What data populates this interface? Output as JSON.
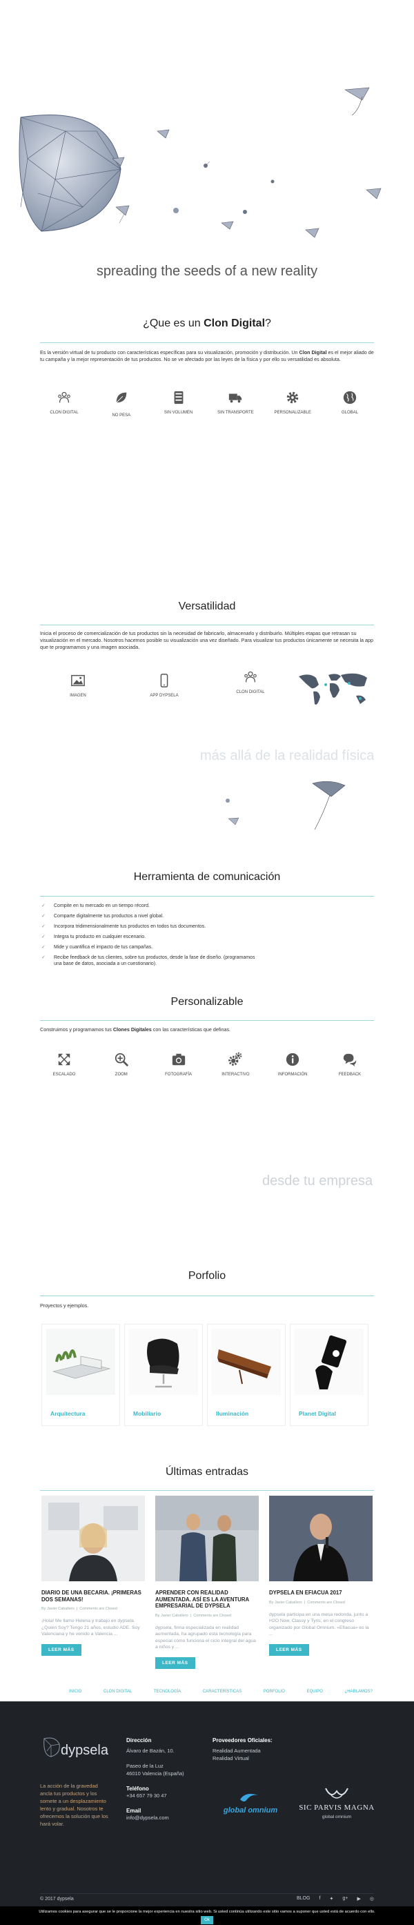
{
  "hero": {
    "tagline": "spreading the seeds of a new reality"
  },
  "que_es": {
    "title_prefix": "¿Que es un ",
    "title_bold": "Clon Digital",
    "title_suffix": "?",
    "p1": "Es la versión virtual de tu producto con características específicas para su visualización, promoción y distribución. Un ",
    "p_bold": "Clon Digital",
    "p2": " es el mejor aliado de tu campaña y la mejor representación de tus productos. No se ve afectado por las leyes de la física y por ello su versatilidad es absoluta.",
    "features": [
      {
        "label": "CLON DIGITAL",
        "icon": "users-icon"
      },
      {
        "label": "NO PESA",
        "icon": "leaf-icon"
      },
      {
        "label": "SIN VOLUMEN",
        "icon": "server-icon"
      },
      {
        "label": "SIN TRANSPORTE",
        "icon": "truck-icon"
      },
      {
        "label": "PERSONALIZABLE",
        "icon": "gear-icon"
      },
      {
        "label": "GLOBAL",
        "icon": "globe-icon"
      }
    ]
  },
  "versatilidad": {
    "title": "Versatilidad",
    "text": "Inicia el proceso de comercialización de tus productos sin la necesidad de fabricarlo, almacenarlo y distribuirlo. Múltiples etapas que retrasan su visualización en el mercado. Nosotros hacemos posible su visualización una vez diseñado. Para visualizar tus productos únicamente se necesita la app que te programamos y una imagen asociada.",
    "items": [
      {
        "label": "IMAGEN",
        "icon": "image-icon"
      },
      {
        "label": "APP DYPSELA",
        "icon": "mobile-icon"
      },
      {
        "label": "CLON DIGITAL",
        "icon": "users-icon"
      }
    ]
  },
  "banner1": "más allá de la realidad física",
  "herramienta": {
    "title": "Herramienta de comunicación",
    "items": [
      "Compite en tu mercado en un tiempo récord.",
      "Comparte digitalmente tus productos a nivel global.",
      "Incorpora tridimensionalmente tus productos en todos tus documentos.",
      "Integra tu producto en cualquier escenario.",
      "Mide y cuantifica el impacto de tus campañas.",
      "Recibe feedback de tus clientes, sobre tus productos, desde la fase de diseño. (programamos una base de datos, asociada a un cuestionario)."
    ]
  },
  "personalizable": {
    "title": "Personalizable",
    "text1": "Construimos y programamos tus ",
    "text_bold": "Clones Digitales",
    "text2": " con las características que definas.",
    "items": [
      {
        "label": "ESCALADO",
        "icon": "expand-icon"
      },
      {
        "label": "ZOOM",
        "icon": "zoom-icon"
      },
      {
        "label": "FOTOGRAFÍA",
        "icon": "camera-icon"
      },
      {
        "label": "INTERACTIVO",
        "icon": "gears-icon"
      },
      {
        "label": "INFORMACIÓN",
        "icon": "info-icon"
      },
      {
        "label": "FEEDBACK",
        "icon": "comments-icon"
      }
    ]
  },
  "banner2": "desde tu empresa",
  "porfolio": {
    "title": "Porfolio",
    "subtitle": "Proyectos y ejemplos.",
    "items": [
      {
        "label": "Arquitectura"
      },
      {
        "label": "Mobiliario"
      },
      {
        "label": "Iluminación"
      },
      {
        "label": "Planet Digital"
      }
    ]
  },
  "entradas": {
    "title": "Últimas entradas",
    "read_more": "LEER MÁS",
    "posts": [
      {
        "title": "DIARIO DE UNA BECARIA. ¡PRIMERAS DOS SEMANAS!",
        "author": "By Javier Caballero",
        "comments": "Comments are Closed",
        "excerpt": "¡Hola! Me llamo Helena y trabajo en dypsela. ¿Quién Soy? Tengo 21 años, estudio ADE. Soy Valenciana y he venido a Valencia ..."
      },
      {
        "title": "APRENDER CON REALIDAD AUMENTADA. ASÍ ES LA AVENTURA EMPRESARIAL DE DYPSELA",
        "author": "By Javier Caballero",
        "comments": "Comments are Closed",
        "excerpt": "dypsela, firma especializada en realidad aumentada, ha agrupado esta tecnología para especial cómo funciona el ciclo integral del agua a niños y ..."
      },
      {
        "title": "DYPSELA EN EFIACUA 2017",
        "author": "By Javier Caballero",
        "comments": "Comments are Closed",
        "excerpt": "dypsela participa en una mesa redonda, junto a H2O Now, Classy y Tyris, en el congreso organizado por Global Omnium. «Efiacua» es la ..."
      }
    ]
  },
  "footer_nav": [
    "INICIO",
    "CLON DIGITAL",
    "TECNOLOGÍA",
    "CARACTERÍSTICAS",
    "PORFOLIO",
    "EQUIPO",
    "¿HABLAMOS?"
  ],
  "footer": {
    "brand": "dypsela",
    "brand_text": "La acción de la gravedad ancla tus productos y los somete a un desplazamiento lento y gradual. Nosotros te ofrecemos la solución que los hará volar.",
    "direccion_h": "Dirección",
    "direccion": [
      "Álvaro de Bazán, 10.",
      "",
      "Paseo de la Luz",
      "46010 Valencia (España)"
    ],
    "telefono_h": "Teléfono",
    "telefono": "+34 657 79 30 47",
    "email_h": "Email",
    "email": "info@dypsela.com",
    "proveedores_h": "Proveedores Oficiales:",
    "proveedores": [
      "Realidad Aumentada",
      "Realidad Virtual"
    ],
    "partner1": "global omnium",
    "partner2": "SIC PARVIS MAGNA",
    "partner2_sub": "global omnium",
    "copyright": "© 2017 dypsela",
    "blog": "BLOG"
  },
  "cookie": {
    "text": "Utilizamos cookies para asegurar que se le proporcione la mejor experiencia en nuestra sitio web. Si usted continúa utilizando este sitio vamos a suponer que usted está de acuerdo con ello.",
    "ok": "Ok"
  },
  "colors": {
    "accent": "#3bb7c7",
    "footer_bg": "#1f2328"
  }
}
